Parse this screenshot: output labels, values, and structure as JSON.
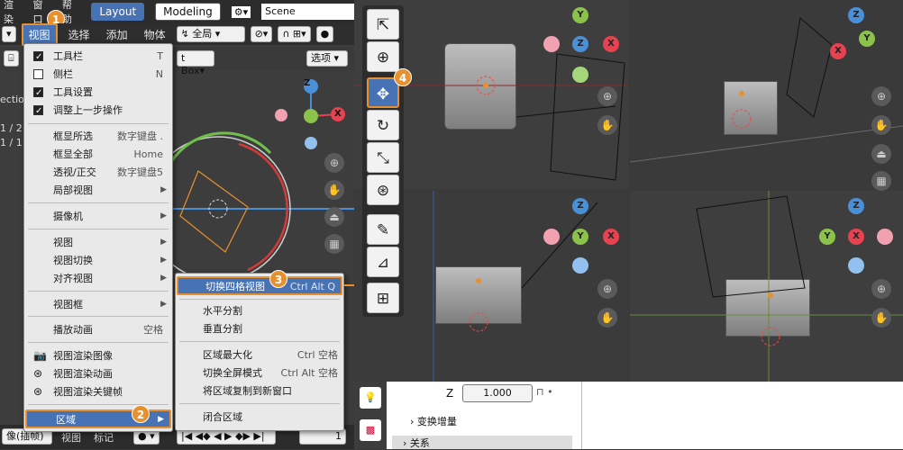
{
  "topbar": {
    "menu1": "渲染",
    "menu2": "窗口",
    "menu3": "帮助",
    "tab_layout": "Layout",
    "tab_modeling": "Modeling",
    "scene_label": "Scene"
  },
  "header": {
    "view": "视图",
    "select": "选择",
    "add": "添加",
    "object": "物体",
    "transform": "全局",
    "options": "选项",
    "textbox": "t Box"
  },
  "left_text": {
    "ection": "ection",
    "n1": "1 / 2",
    "n2": "1 / 1"
  },
  "view_menu": {
    "toolbar": "工具栏",
    "toolbar_sc": "T",
    "sidebar": "侧栏",
    "sidebar_sc": "N",
    "tool_settings": "工具设置",
    "adjust_last": "调整上一步操作",
    "frame_selected": "框显所选",
    "frame_selected_sc": "数字键盘 .",
    "frame_all": "框显全部",
    "frame_all_sc": "Home",
    "persp": "透视/正交",
    "persp_sc": "数字键盘5",
    "local_view": "局部视图",
    "camera": "摄像机",
    "viewpoint": "视图",
    "nav": "视图切换",
    "align": "对齐视图",
    "view_frame": "视图框",
    "playback": "播放动画",
    "playback_sc": "空格",
    "render_image": "视图渲染图像",
    "render_anim": "视图渲染动画",
    "render_keyframes": "视图渲染关键帧",
    "area": "区域"
  },
  "area_menu": {
    "quad": "切换四格视图",
    "quad_sc": "Ctrl Alt Q",
    "hsplit": "水平分割",
    "vsplit": "垂直分割",
    "maximize": "区域最大化",
    "maximize_sc": "Ctrl 空格",
    "fullscreen": "切换全屏模式",
    "fullscreen_sc": "Ctrl Alt 空格",
    "duplicate": "将区域复制到新窗口",
    "close": "闭合区域"
  },
  "bottom_left": {
    "mode": "像(插帧)",
    "view": "视图",
    "marker": "标记",
    "frame": "1"
  },
  "props": {
    "z_label": "Z",
    "z_value": "1.000",
    "delta": "变换增量",
    "relations": "关系"
  },
  "badges": [
    "1",
    "2",
    "3",
    "4"
  ],
  "gizmo": {
    "x": "X",
    "y": "Y",
    "z": "Z"
  },
  "colors": {
    "accent": "#4772b3",
    "badge": "#e8902d",
    "x": "#e8414f",
    "y": "#8bc34a",
    "z": "#4a90d9"
  }
}
